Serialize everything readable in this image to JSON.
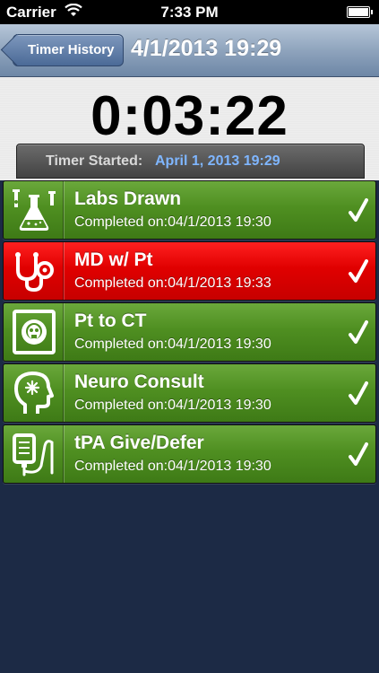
{
  "status_bar": {
    "carrier": "Carrier",
    "time": "7:33 PM",
    "wifi_icon": "wifi-icon",
    "battery_icon": "battery-icon"
  },
  "nav": {
    "back_label": "Timer History",
    "title": "4/1/2013 19:29"
  },
  "timer": {
    "elapsed": "0:03:22",
    "started_label": "Timer Started:",
    "started_value": "April 1, 2013 19:29"
  },
  "colors": {
    "complete_green": "#4f8f21",
    "alert_red": "#e00000",
    "started_value_blue": "#7fb6ff"
  },
  "tasks": [
    {
      "title": "Labs Drawn",
      "completed": "Completed on:04/1/2013 19:30",
      "status": "green",
      "icon": "lab-flask-icon"
    },
    {
      "title": "MD w/ Pt",
      "completed": "Completed on:04/1/2013 19:33",
      "status": "red",
      "icon": "stethoscope-icon"
    },
    {
      "title": "Pt to CT",
      "completed": "Completed on:04/1/2013 19:30",
      "status": "green",
      "icon": "ct-scan-icon"
    },
    {
      "title": "Neuro Consult",
      "completed": "Completed on:04/1/2013 19:30",
      "status": "green",
      "icon": "neuro-head-icon"
    },
    {
      "title": "tPA Give/Defer",
      "completed": "Completed on:04/1/2013 19:30",
      "status": "green",
      "icon": "iv-drip-icon"
    }
  ]
}
